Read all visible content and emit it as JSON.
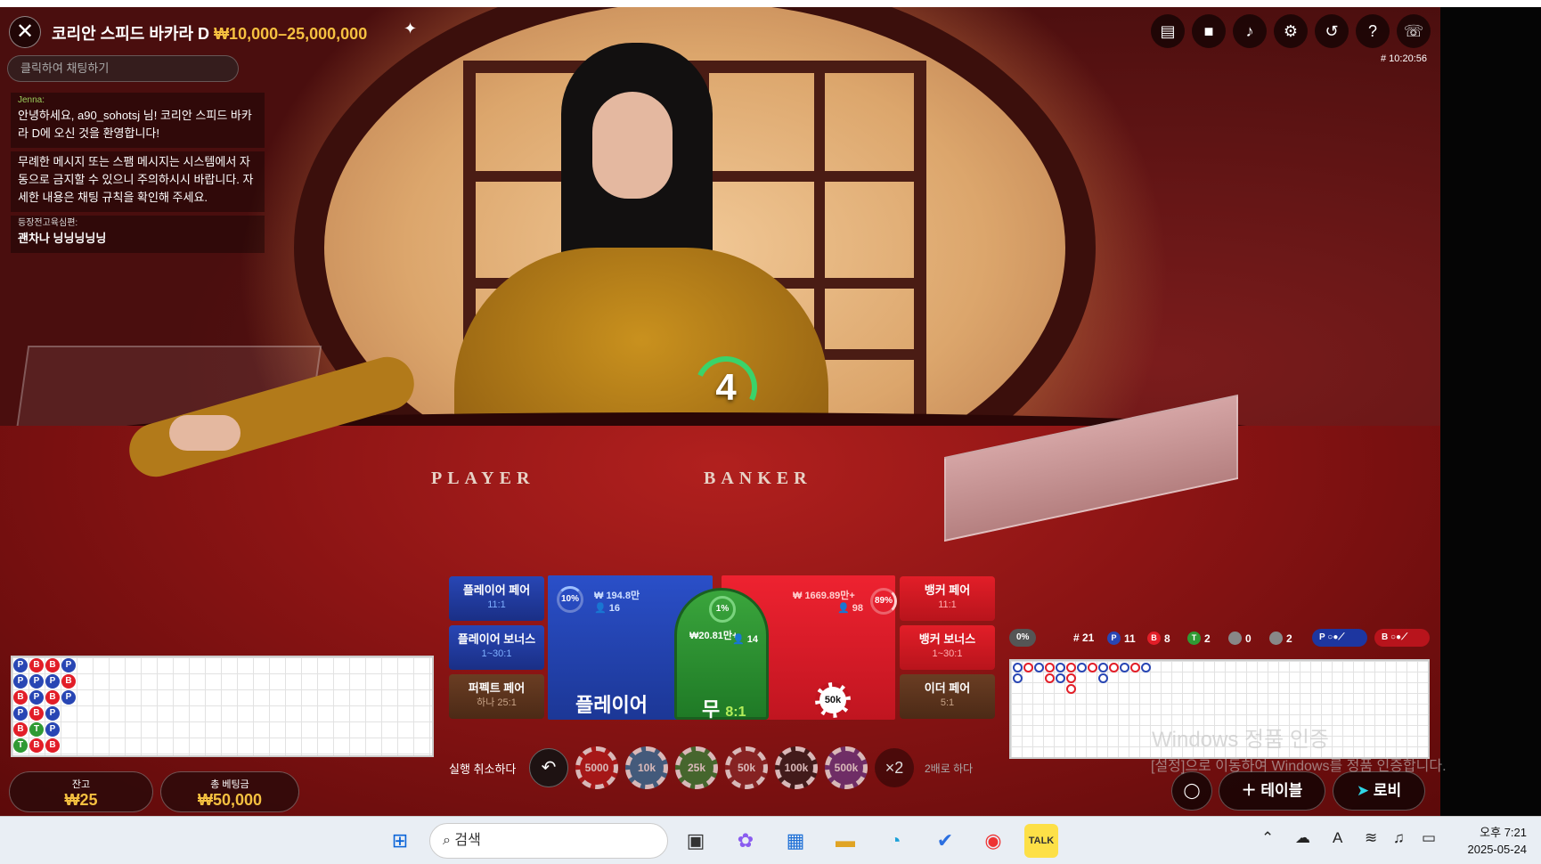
{
  "header": {
    "title": "코리안 스피드 바카라 D",
    "limits": "₩10,000–25,000,000",
    "game_id": "# 10:20:56"
  },
  "top_buttons": [
    "chat-icon",
    "video-icon",
    "sound-icon",
    "gear-icon",
    "history-icon",
    "help-icon",
    "support-icon"
  ],
  "chat": {
    "placeholder": "클릭하여 채팅하기",
    "messages": [
      {
        "author": "Jenna:",
        "text": "안녕하세요, a90_sohotsj 님! 코리안 스피드 바카라 D에 오신 것을 환영합니다!"
      },
      {
        "author": "",
        "text": "무례한 메시지 또는 스팸 메시지는 시스템에서 자동으로 금지할 수 있으니 주의하시시 바랍니다. 자세한 내용은 채팅 규칙을 확인해 주세요."
      },
      {
        "author": "등장전고육심편:",
        "text": "괜차나 닝닝닝닝닝"
      }
    ]
  },
  "table_labels": {
    "player": "PLAYER",
    "banker": "BANKER"
  },
  "timer": "4",
  "bets": {
    "player_pair": {
      "label": "플레이어 페어",
      "odds": "11:1"
    },
    "player_bonus": {
      "label": "플레이어 보너스",
      "odds": "1~30:1"
    },
    "perfect_pair": {
      "label": "퍼펙트 페어",
      "odds": "하나 25:1"
    },
    "banker_pair": {
      "label": "뱅커 페어",
      "odds": "11:1"
    },
    "banker_bonus": {
      "label": "뱅커 보너스",
      "odds": "1~30:1"
    },
    "either_pair": {
      "label": "이더 페어",
      "odds": "5:1"
    },
    "player": {
      "label": "플레이어",
      "pct": "10%",
      "amount": "₩ 194.8만",
      "players": "16"
    },
    "tie": {
      "label": "무",
      "odds": "8:1",
      "pct": "1%",
      "amount": "₩20.81만+",
      "players": "14"
    },
    "banker": {
      "pct": "89%",
      "amount": "₩ 1669.89만+",
      "players": "98",
      "chip": "50k"
    }
  },
  "chips": {
    "undo_label": "실행 취소하다",
    "undo_icon": "undo-icon",
    "values": [
      "5000",
      "10k",
      "25k",
      "50k",
      "100k",
      "500k"
    ],
    "colors": [
      "#b81c1c",
      "#2c7aa8",
      "#2f8a3a",
      "#8a2a2a",
      "#2a2020",
      "#6a3a8a"
    ],
    "double": "×2",
    "double_label": "2배로 하다"
  },
  "wallet": {
    "balance_label": "잔고",
    "balance": "₩25",
    "total_bet_label": "총 베팅금",
    "total_bet": "₩50,000"
  },
  "bead_road": [
    [
      "P",
      "P",
      "B",
      "P",
      "B",
      "T"
    ],
    [
      "B",
      "P",
      "P",
      "B",
      "T",
      "B"
    ],
    [
      "B",
      "P",
      "B",
      "P",
      "P",
      "B"
    ],
    [
      "P",
      "B",
      "P",
      "",
      "",
      ""
    ]
  ],
  "stats": {
    "shoe_pct": "0%",
    "round": "# 21",
    "player_wins": "11",
    "banker_wins": "8",
    "ties": "2",
    "player_pairs": "0",
    "banker_pairs": "2",
    "p_marker": "P",
    "b_marker": "B"
  },
  "bottom_buttons": {
    "add_table": "테이블",
    "lobby": "로비"
  },
  "watermark": {
    "line1": "Windows 정품 인증",
    "line2": "[설정]으로 이동하여 Windows를 정품 인증합니다."
  },
  "taskbar": {
    "search_placeholder": "검색",
    "time": "오후 7:21",
    "date": "2025-05-24"
  },
  "colors": {
    "player_blue": "#2846b4",
    "banker_red": "#e21e28",
    "tie_green": "#2f9a34",
    "gold": "#f5c040"
  }
}
